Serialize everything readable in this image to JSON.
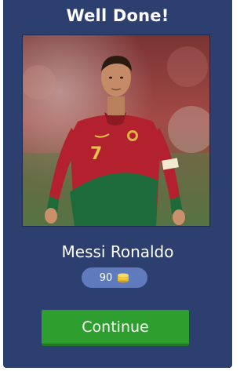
{
  "header": {
    "title": "Well Done!"
  },
  "photo": {
    "subject": "player-photo"
  },
  "answer": {
    "name": "Messi Ronaldo"
  },
  "reward": {
    "coins": "90",
    "icon": "coin-stack-icon"
  },
  "actions": {
    "continue_label": "Continue"
  },
  "colors": {
    "panel": "#2c3f6f",
    "coin_pill": "#5f7bbd",
    "button": "#2e9e2e",
    "jersey_red": "#b3212e",
    "jersey_green": "#1d6b3a"
  }
}
